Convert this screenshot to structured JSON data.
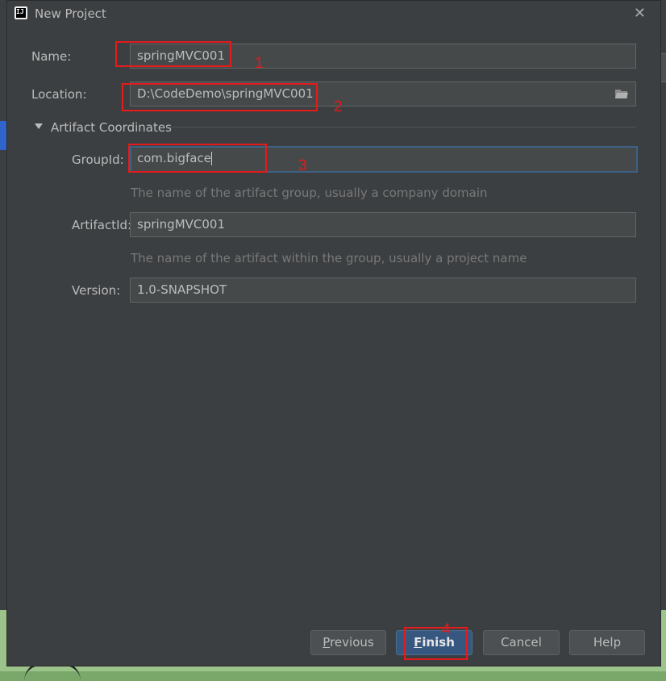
{
  "window": {
    "title": "New Project",
    "close_glyph": "✕",
    "icon": "intellij-icon",
    "icon_text": "IJ"
  },
  "form": {
    "name_label": "Name:",
    "name_value": "springMVC001",
    "location_label": "Location:",
    "location_value": "D:\\CodeDemo\\springMVC001",
    "section_title": "Artifact Coordinates",
    "groupid_label": "GroupId:",
    "groupid_value": "com.bigface",
    "groupid_hint": "The name of the artifact group, usually a company domain",
    "artifactid_label": "ArtifactId:",
    "artifactid_value": "springMVC001",
    "artifactid_hint": "The name of the artifact within the group, usually a project name",
    "version_label": "Version:",
    "version_value": "1.0-SNAPSHOT"
  },
  "buttons": {
    "previous_mnemonic": "P",
    "previous_rest": "revious",
    "finish_mnemonic": "F",
    "finish_rest": "inish",
    "cancel": "Cancel",
    "help": "Help"
  },
  "annotations": [
    "1",
    "2",
    "3",
    "4"
  ],
  "colors": {
    "annotation_red": "#e31b1b",
    "dialog_bg": "#3c3f41",
    "focus_border": "#3d6185",
    "default_button": "#365880"
  }
}
